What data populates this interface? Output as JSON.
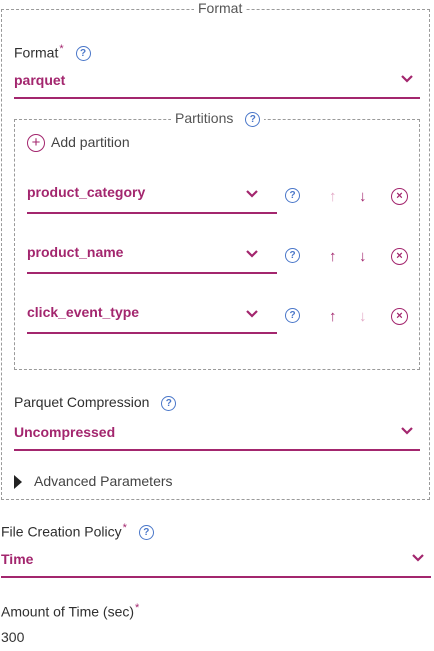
{
  "format_section": {
    "legend": "Format",
    "format_label": "Format",
    "format_value": "parquet",
    "partitions_legend": "Partitions",
    "add_partition": "Add partition",
    "partitions": [
      {
        "value": "product_category"
      },
      {
        "value": "product_name"
      },
      {
        "value": "click_event_type"
      }
    ],
    "compression_label": "Parquet Compression",
    "compression_value": "Uncompressed",
    "advanced": "Advanced Parameters"
  },
  "file_creation": {
    "label": "File Creation Policy",
    "value": "Time"
  },
  "amount": {
    "label": "Amount of Time (sec)",
    "value": "300"
  },
  "symbols": {
    "required": "*",
    "help": "?",
    "up": "↑",
    "down": "↓",
    "remove": "×",
    "plus": "+"
  },
  "colors": {
    "accent": "#a3266e",
    "help": "#4a77c9"
  }
}
